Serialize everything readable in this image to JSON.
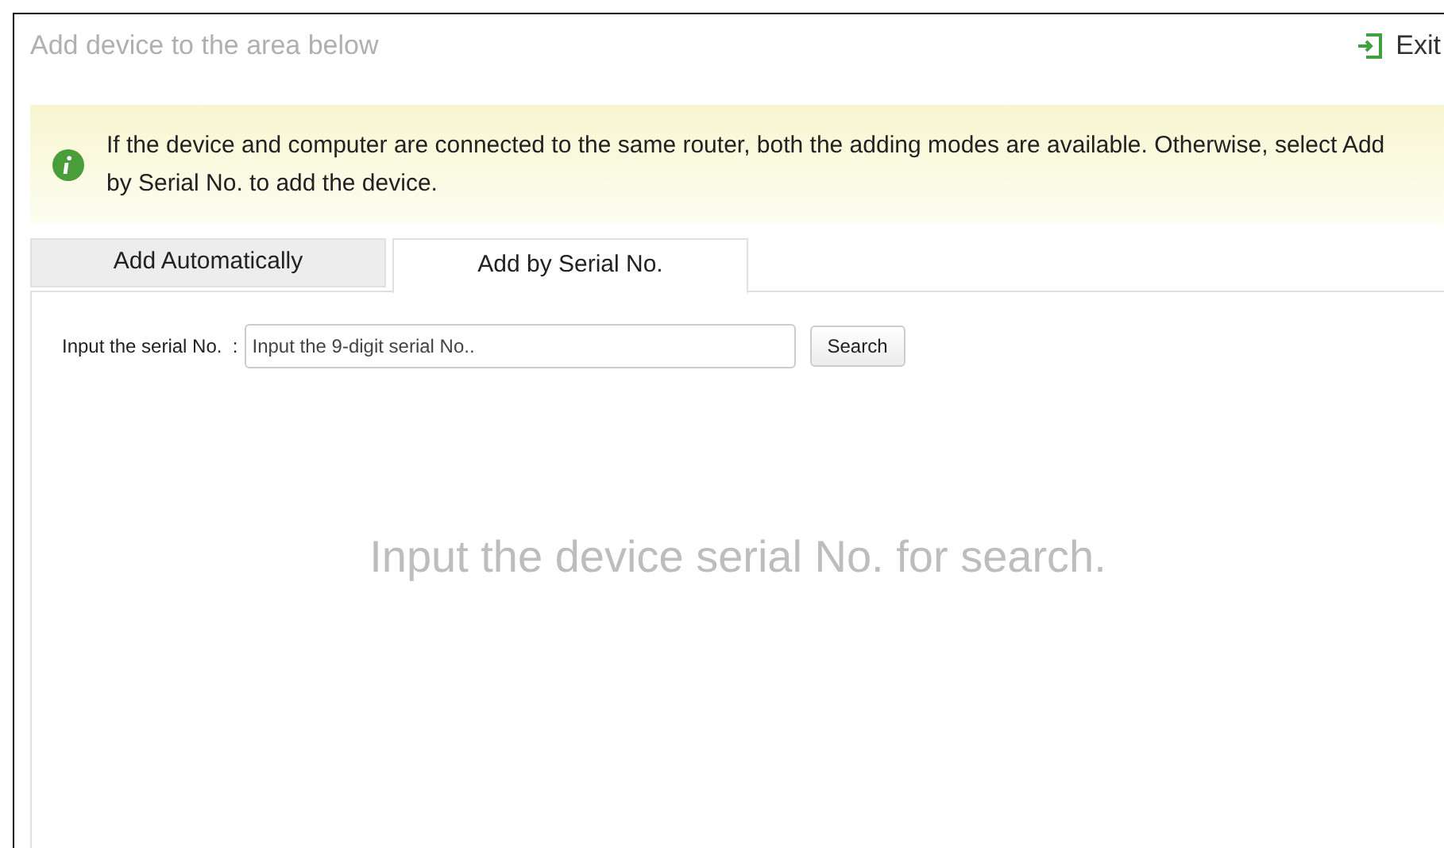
{
  "header": {
    "title": "Add device to the area below",
    "exit_label": "Exit"
  },
  "notice": {
    "text": "If the device and computer are connected to the same router, both the adding modes are available. Otherwise, select Add by Serial No. to add the device."
  },
  "tabs": [
    {
      "label": "Add Automatically",
      "selected": false
    },
    {
      "label": "Add by Serial No.",
      "selected": true
    }
  ],
  "serial_search": {
    "label": "Input the serial No.  :",
    "placeholder": "Input the 9-digit serial No..",
    "button": "Search"
  },
  "empty_message": "Input the device serial No. for search."
}
